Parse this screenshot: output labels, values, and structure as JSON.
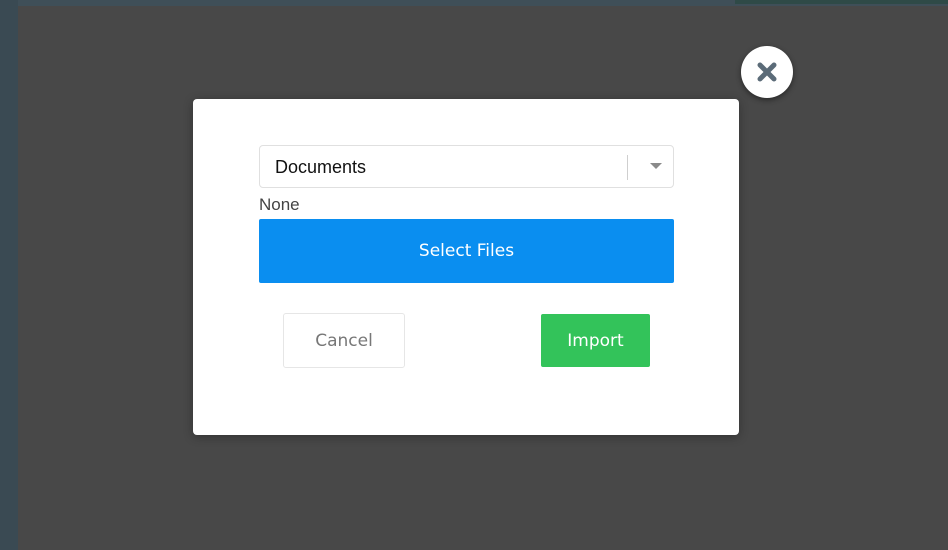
{
  "dialog": {
    "folder_select": {
      "selected_value": "Documents"
    },
    "file_status": "None",
    "select_files_label": "Select Files",
    "cancel_label": "Cancel",
    "import_label": "Import"
  },
  "icons": {
    "close": "close-icon",
    "dropdown": "chevron-down-icon"
  },
  "colors": {
    "overlay": "#484848",
    "select_files_button": "#0a8ef0",
    "import_button": "#33c35a",
    "close_icon": "#5b6b78"
  }
}
